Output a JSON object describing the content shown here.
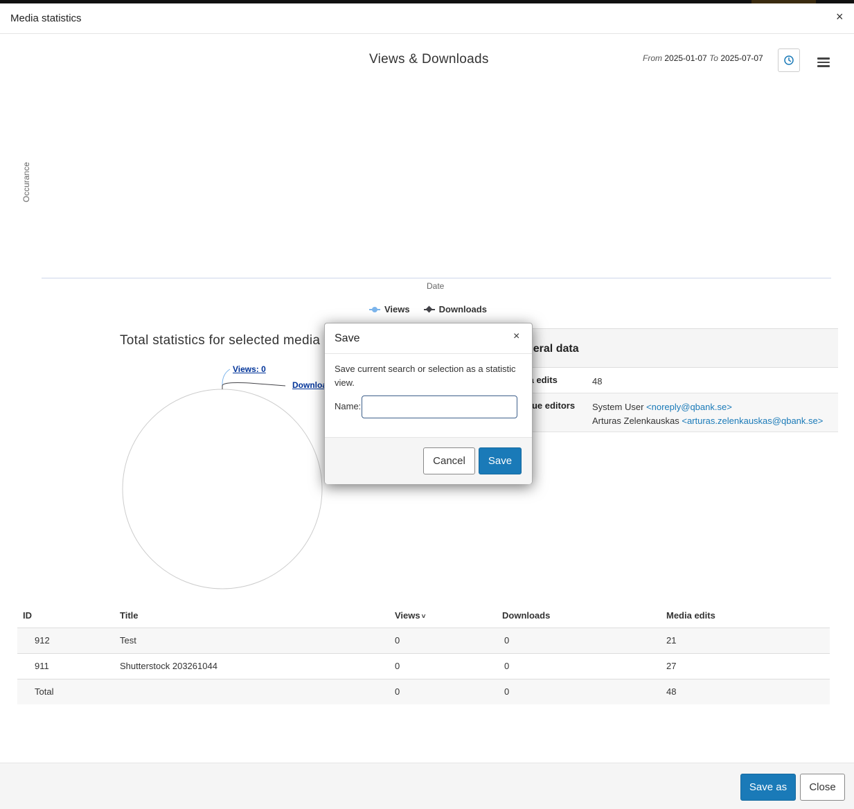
{
  "modal": {
    "title": "Media statistics",
    "close": "×"
  },
  "chart": {
    "title": "Views & Downloads",
    "range": {
      "from_label": "From",
      "from": "2025-01-07",
      "to_label": "To",
      "to": "2025-07-07"
    },
    "ylabel": "Occurance",
    "xlabel": "Date",
    "legend": [
      {
        "name": "Views",
        "color": "#7cb5ec"
      },
      {
        "name": "Downloads",
        "color": "#434348"
      }
    ]
  },
  "chart_data": [
    {
      "type": "line",
      "title": "Views & Downloads",
      "xlabel": "Date",
      "ylabel": "Occurance",
      "series": [
        {
          "name": "Views",
          "values": []
        },
        {
          "name": "Downloads",
          "values": []
        }
      ],
      "legend": "bottom-center"
    },
    {
      "type": "pie",
      "title": "Total statistics for selected media",
      "categories": [
        "Views",
        "Downloads"
      ],
      "values": [
        0,
        0
      ]
    }
  ],
  "pie": {
    "title": "Total statistics for selected media",
    "views_label": "Views: 0",
    "downloads_label": "Downloa"
  },
  "general": {
    "heading": "neral data",
    "rows": [
      {
        "key": "ia edits",
        "value": "48"
      },
      {
        "key": "que editors",
        "editors": [
          {
            "name": "System User",
            "email": "<noreply@qbank.se>"
          },
          {
            "name": "Arturas Zelenkauskas",
            "email": "<arturas.zelenkauskas@qbank.se>"
          }
        ]
      }
    ]
  },
  "table": {
    "columns": {
      "id": "ID",
      "title": "Title",
      "views": "Views",
      "downloads": "Downloads",
      "edits": "Media edits"
    },
    "sort_indicator": "˅",
    "rows": [
      {
        "id": "912",
        "title": "Test",
        "views": "0",
        "downloads": "0",
        "edits": "21"
      },
      {
        "id": "911",
        "title": "Shutterstock 203261044",
        "views": "0",
        "downloads": "0",
        "edits": "27"
      }
    ],
    "total": {
      "label": "Total",
      "views": "0",
      "downloads": "0",
      "edits": "48"
    }
  },
  "footer": {
    "save_as": "Save as",
    "close": "Close"
  },
  "dialog": {
    "title": "Save",
    "close": "×",
    "message": "Save current search or selection as a statistic view.",
    "name_label": "Name:",
    "name_value": "",
    "cancel": "Cancel",
    "save": "Save"
  },
  "colors": {
    "primary": "#1a7ab8",
    "link": "#1a7ab8",
    "views": "#7cb5ec",
    "downloads": "#434348"
  }
}
